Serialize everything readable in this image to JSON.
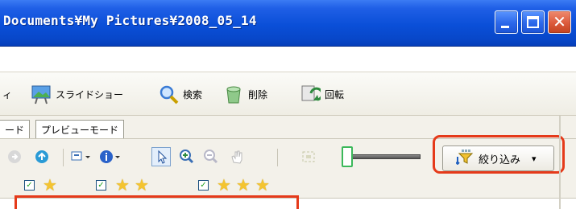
{
  "window": {
    "title": "Documents¥My Pictures¥2008_05_14",
    "controls": [
      "minimize",
      "maximize",
      "close"
    ],
    "colors": {
      "titlebar": "#0a4fd8",
      "close": "#dc5a3c"
    }
  },
  "commandbar": {
    "cut_label": "ィ",
    "slideshow": "スライドショー",
    "search": "検索",
    "delete": "削除",
    "rotate": "回転"
  },
  "tabs": [
    {
      "label": "ード"
    },
    {
      "label": "プレビューモード"
    }
  ],
  "toolbar": {
    "filter_label": "絞り込み",
    "filter_dropdown": "▾",
    "icons": [
      "forward-icon",
      "up-icon",
      "view-icon",
      "info-icon",
      "select-icon",
      "zoom-in-icon",
      "zoom-out-icon",
      "hand-icon",
      "fit-icon",
      "size-slider"
    ]
  },
  "rating_filters": [
    {
      "checked": true,
      "stars": 1
    },
    {
      "checked": true,
      "stars": 2
    },
    {
      "checked": true,
      "stars": 3
    }
  ],
  "annotations": {
    "highlight_color": "#e53a1a"
  }
}
